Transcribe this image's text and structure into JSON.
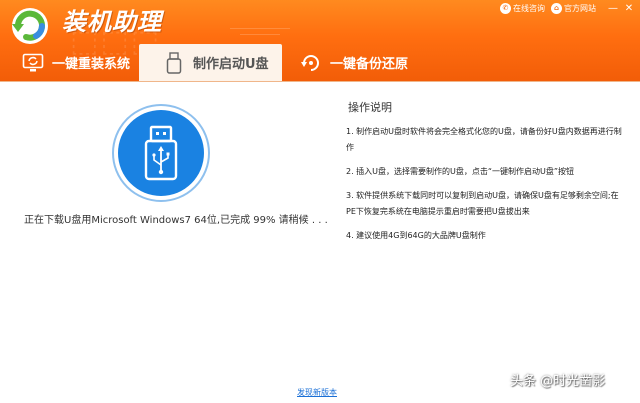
{
  "app": {
    "title": "装机助理",
    "logo_icon": "refresh-logo-icon"
  },
  "top_links": [
    {
      "label": "在线咨询",
      "icon": "chat-icon"
    },
    {
      "label": "官方网站",
      "icon": "home-icon"
    }
  ],
  "window_controls": {
    "minimize": "—",
    "close": "✕"
  },
  "tabs": [
    {
      "label": "一键重装系统",
      "icon": "reinstall-icon",
      "active": false
    },
    {
      "label": "制作启动U盘",
      "icon": "usb-drive-icon",
      "active": true
    },
    {
      "label": "一键备份还原",
      "icon": "backup-restore-icon",
      "active": false
    }
  ],
  "main": {
    "usb_icon": "usb-icon",
    "progress_text": "正在下载U盘用Microsoft Windows7 64位,已完成 99% 请稍候 . . .",
    "progress_percent": 99
  },
  "instructions": {
    "title": "操作说明",
    "items": [
      "1.  制作启动U盘时软件将会完全格式化您的U盘，请备份好U盘内数据再进行制作",
      "2.  插入U盘，选择需要制作的U盘，点击“一键制作启动U盘”按钮",
      "3.  软件提供系统下载同时可以复制到启动U盘，请确保U盘有足够剩余空间;在PE下恢复完系统在电脑提示重启时需要把U盘拔出来",
      "4.  建议使用4G到64G的大品牌U盘制作"
    ]
  },
  "footer": {
    "new_version_link": "发现新版本"
  },
  "watermark": "头条 @时光凿影",
  "colors": {
    "header_orange": "#f56b10",
    "usb_blue": "#1a82e2",
    "link_blue": "#1a6fd6"
  }
}
